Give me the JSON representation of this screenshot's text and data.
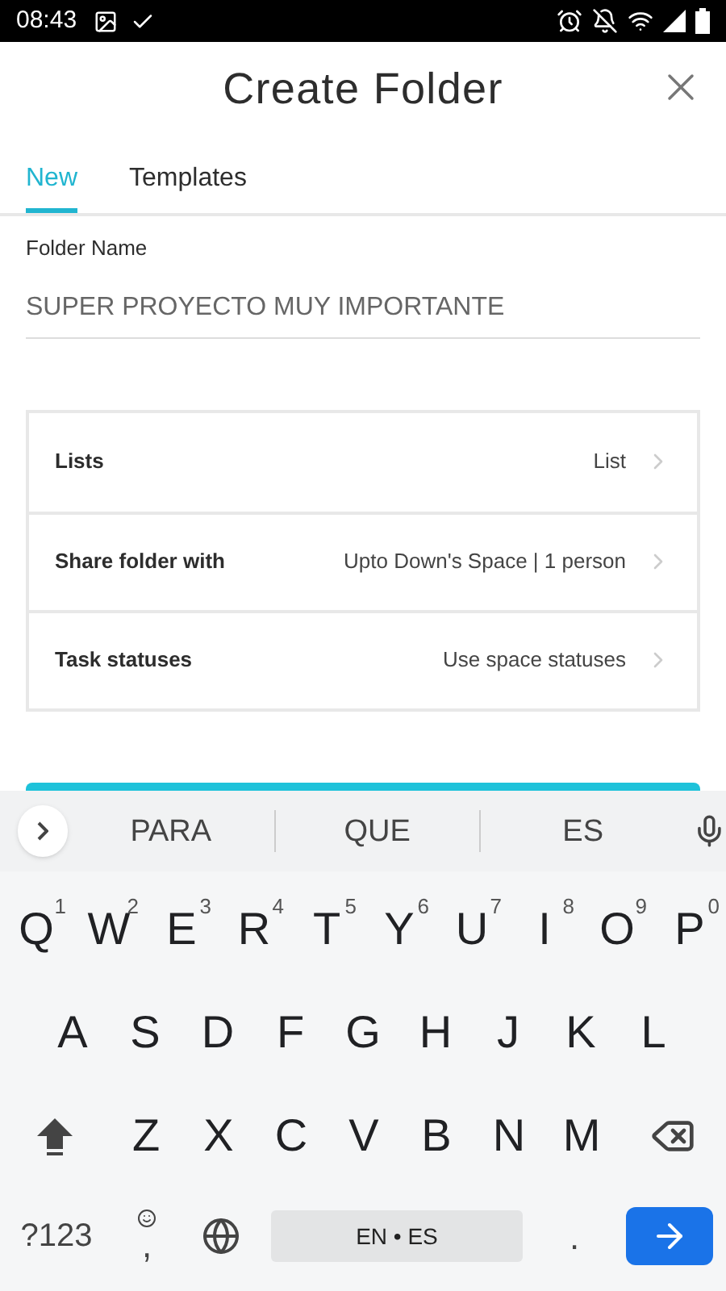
{
  "status_bar": {
    "time": "08:43"
  },
  "header": {
    "title": "Create Folder"
  },
  "tabs": [
    {
      "label": "New",
      "selected": true
    },
    {
      "label": "Templates",
      "selected": false
    }
  ],
  "folder_name": {
    "label": "Folder Name",
    "value": "SUPER PROYECTO MUY IMPORTANTE"
  },
  "options": [
    {
      "label": "Lists",
      "value": "List"
    },
    {
      "label": "Share folder with",
      "value": "Upto Down's Space | 1 person"
    },
    {
      "label": "Task statuses",
      "value": "Use space statuses"
    }
  ],
  "keyboard": {
    "suggestions": [
      "PARA",
      "QUE",
      "ES"
    ],
    "rows": [
      [
        {
          "label": "Q",
          "hint": "1"
        },
        {
          "label": "W",
          "hint": "2"
        },
        {
          "label": "E",
          "hint": "3"
        },
        {
          "label": "R",
          "hint": "4"
        },
        {
          "label": "T",
          "hint": "5"
        },
        {
          "label": "Y",
          "hint": "6"
        },
        {
          "label": "U",
          "hint": "7"
        },
        {
          "label": "I",
          "hint": "8"
        },
        {
          "label": "O",
          "hint": "9"
        },
        {
          "label": "P",
          "hint": "0"
        }
      ],
      [
        {
          "label": "A"
        },
        {
          "label": "S"
        },
        {
          "label": "D"
        },
        {
          "label": "F"
        },
        {
          "label": "G"
        },
        {
          "label": "H"
        },
        {
          "label": "J"
        },
        {
          "label": "K"
        },
        {
          "label": "L"
        }
      ],
      [
        {
          "label": "Z"
        },
        {
          "label": "X"
        },
        {
          "label": "C"
        },
        {
          "label": "V"
        },
        {
          "label": "B"
        },
        {
          "label": "N"
        },
        {
          "label": "M"
        }
      ]
    ],
    "symbols_key": "?123",
    "comma_key": ",",
    "space_key": "EN • ES",
    "period_key": "."
  }
}
